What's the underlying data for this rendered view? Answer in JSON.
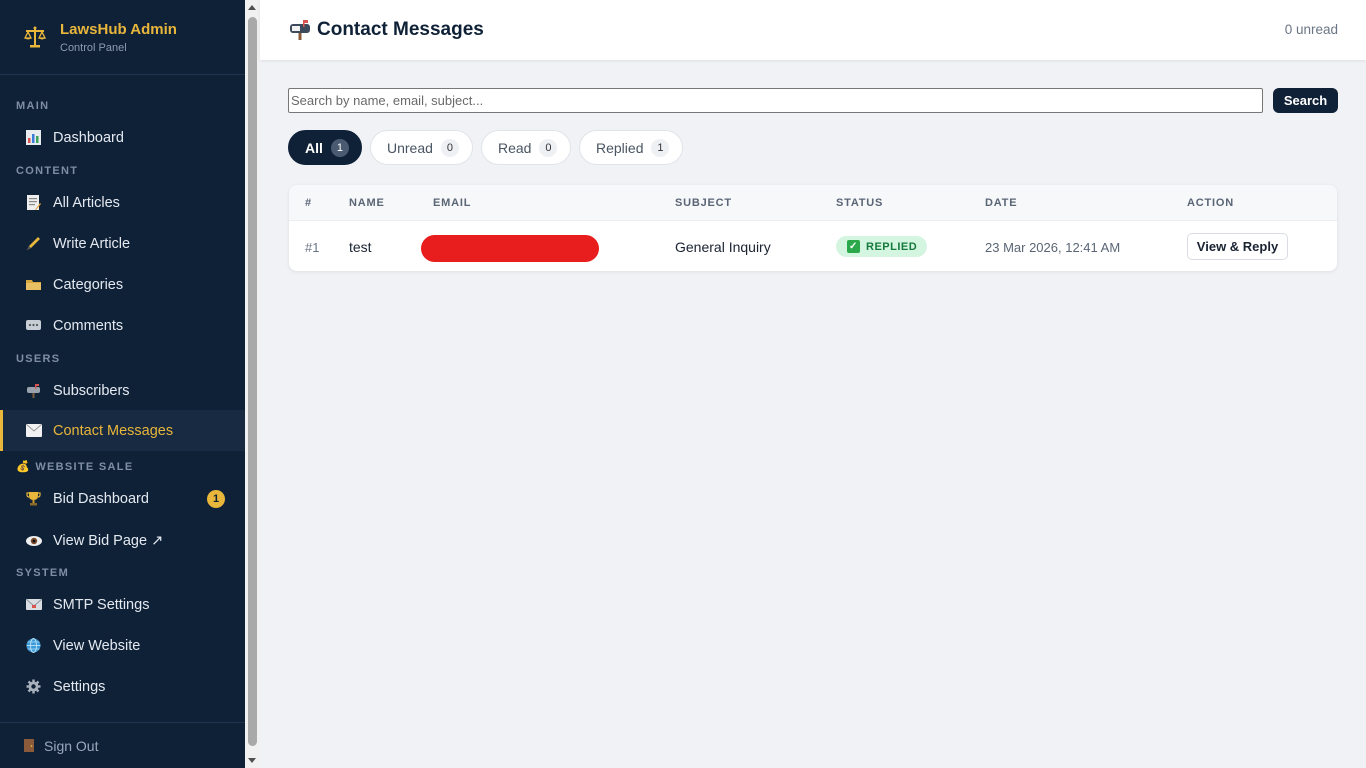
{
  "brand": {
    "title": "LawsHub Admin",
    "subtitle": "Control Panel",
    "accent": "#e8b63a"
  },
  "sidebar": {
    "sections": [
      "MAIN",
      "CONTENT",
      "USERS",
      "💰 WEBSITE SALE",
      "SYSTEM"
    ],
    "items": [
      {
        "label": "Dashboard",
        "icon": "bar-chart-icon"
      },
      {
        "label": "All Articles",
        "icon": "memo-icon"
      },
      {
        "label": "Write Article",
        "icon": "pencil-icon"
      },
      {
        "label": "Categories",
        "icon": "folder-icon"
      },
      {
        "label": "Comments",
        "icon": "speech-bubble-icon"
      },
      {
        "label": "Subscribers",
        "icon": "mailbox-icon"
      },
      {
        "label": "Contact Messages",
        "icon": "envelope-icon",
        "active": true
      },
      {
        "label": "Bid Dashboard",
        "icon": "trophy-icon",
        "badge": "1"
      },
      {
        "label": "View Bid Page ↗",
        "icon": "eye-icon"
      },
      {
        "label": "SMTP Settings",
        "icon": "email-icon"
      },
      {
        "label": "View Website",
        "icon": "globe-icon"
      },
      {
        "label": "Settings",
        "icon": "gear-icon"
      }
    ],
    "signout": "Sign Out"
  },
  "header": {
    "title": "Contact Messages",
    "unread": "0 unread"
  },
  "search": {
    "placeholder": "Search by name, email, subject...",
    "button": "Search"
  },
  "filters": [
    {
      "label": "All",
      "count": "1",
      "active": true
    },
    {
      "label": "Unread",
      "count": "0"
    },
    {
      "label": "Read",
      "count": "0"
    },
    {
      "label": "Replied",
      "count": "1"
    }
  ],
  "table": {
    "columns": [
      "#",
      "NAME",
      "EMAIL",
      "SUBJECT",
      "STATUS",
      "DATE",
      "ACTION"
    ],
    "rows": [
      {
        "id": "#1",
        "name": "test",
        "email": "",
        "subject": "General Inquiry",
        "status": "REPLIED",
        "date": "23 Mar 2026, 12:41 AM",
        "action": "View & Reply"
      }
    ]
  }
}
